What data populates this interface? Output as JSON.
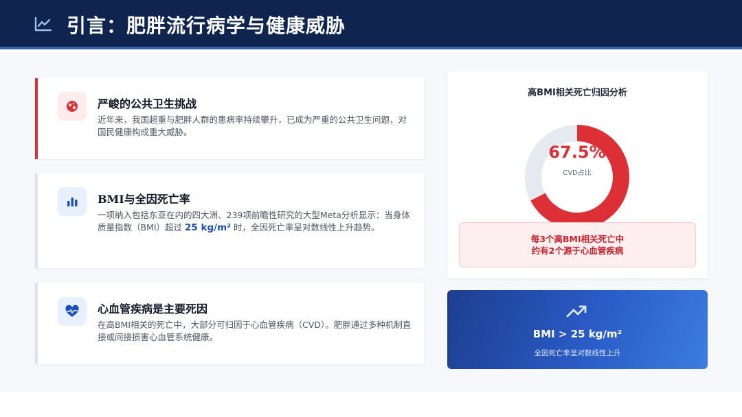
{
  "header": {
    "title": "引言：肥胖流行病学与健康威胁",
    "icon": "line-chart-icon"
  },
  "cards": [
    {
      "title": "严峻的公共卫生挑战",
      "body": "近年来，我国超重与肥胖人群的患病率持续攀升，已成为严重的公共卫生问题，对国民健康构成重大威胁。",
      "icon": "globe-virus-icon"
    },
    {
      "title": "BMI与全因死亡率",
      "body_before": "一项纳入包括东亚在内的四大洲、239项前瞻性研究的大型Meta分析显示：当身体质量指数（BMI）超过 ",
      "body_highlight": "25 kg/m²",
      "body_after": " 时，全因死亡率呈对数线性上升趋势。",
      "icon": "bar-chart-icon"
    },
    {
      "title": "心血管疾病是主要死因",
      "body": "在高BMI相关的死亡中，大部分可归因于心血管疾病（CVD）。肥胖通过多种机制直接或间接损害心血管系统健康。",
      "icon": "heartbeat-icon"
    }
  ],
  "chart_data": {
    "type": "pie",
    "title": "高BMI相关死亡归因分析",
    "center_value": "67.5%",
    "center_label": "CVD占比",
    "slices": [
      {
        "value": 67.5,
        "color": "#dc2f36"
      },
      {
        "value": 32.5,
        "color": "#e5e9f0"
      }
    ]
  },
  "alert": {
    "line1": "每3个高BMI相关死亡中",
    "line2": "约有2个源于心血管疾病"
  },
  "stat": {
    "value": "BMI > 25 kg/m²",
    "caption": "全因死亡率呈对数线性上升",
    "icon": "trend-up-icon"
  },
  "colors": {
    "header_bg": "#0f2550",
    "accent_red": "#dc2f36",
    "accent_blue": "#1f4fb8"
  }
}
